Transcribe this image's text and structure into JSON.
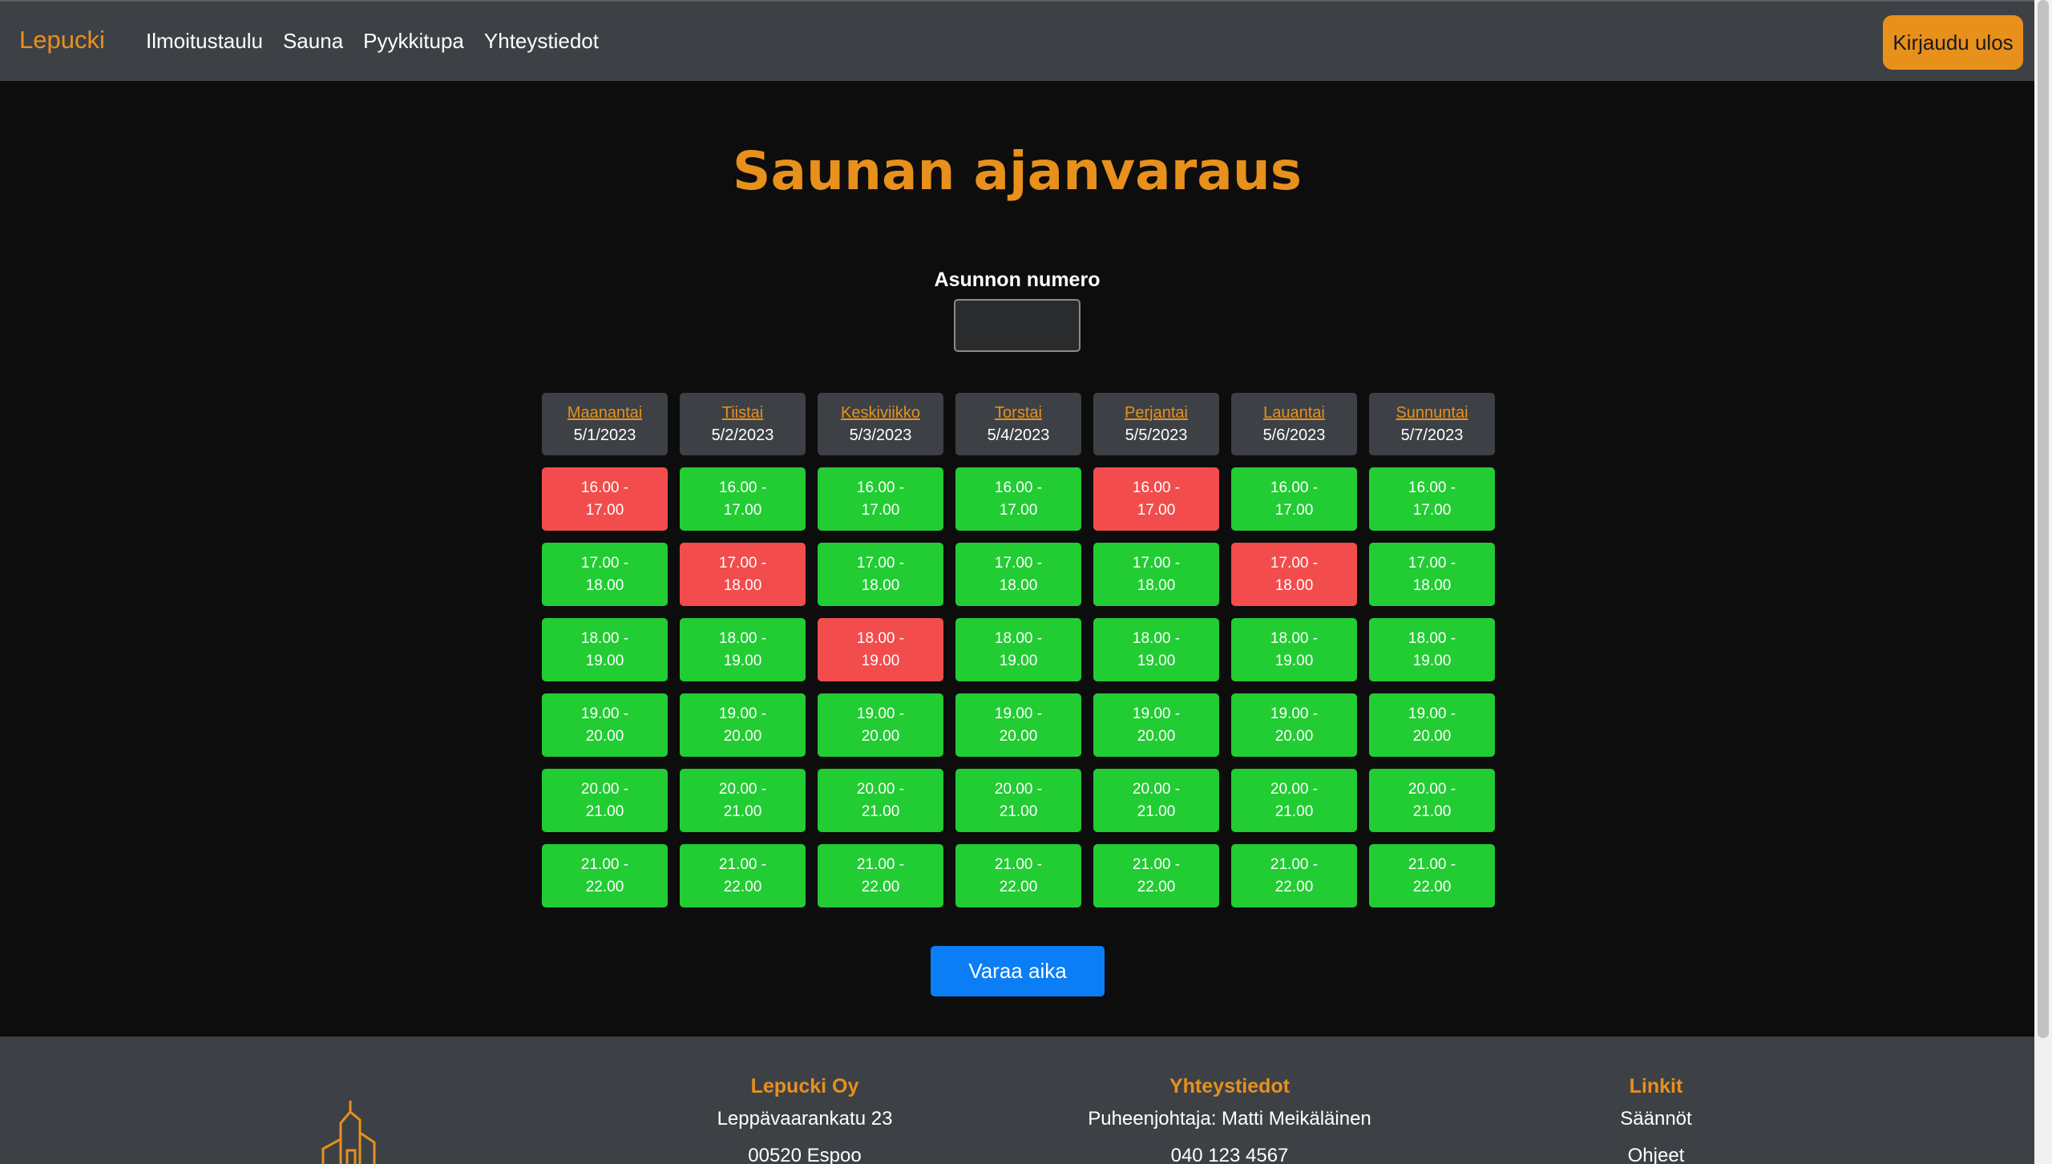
{
  "nav": {
    "brand": "Lepucki",
    "links": [
      "Ilmoitustaulu",
      "Sauna",
      "Pyykkitupa",
      "Yhteystiedot"
    ],
    "logout_label": "Kirjaudu ulos"
  },
  "main": {
    "title": "Saunan ajanvaraus",
    "apartment_label": "Asunnon numero",
    "apartment_value": "",
    "book_button": "Varaa aika"
  },
  "schedule": {
    "days": [
      {
        "name": "Maanantai",
        "date": "5/1/2023"
      },
      {
        "name": "Tiistai",
        "date": "5/2/2023"
      },
      {
        "name": "Keskiviikko",
        "date": "5/3/2023"
      },
      {
        "name": "Torstai",
        "date": "5/4/2023"
      },
      {
        "name": "Perjantai",
        "date": "5/5/2023"
      },
      {
        "name": "Lauantai",
        "date": "5/6/2023"
      },
      {
        "name": "Sunnuntai",
        "date": "5/7/2023"
      }
    ],
    "slots": [
      "16.00 - 17.00",
      "17.00 - 18.00",
      "18.00 - 19.00",
      "19.00 - 20.00",
      "20.00 - 21.00",
      "21.00 - 22.00"
    ],
    "booked": [
      [
        0,
        0
      ],
      [
        1,
        1
      ],
      [
        2,
        2
      ],
      [
        4,
        0
      ],
      [
        5,
        1
      ]
    ],
    "colors": {
      "free": "#22cc33",
      "booked": "#f24c4c",
      "accent": "#e8901c"
    }
  },
  "footer": {
    "company": {
      "title": "Lepucki Oy",
      "lines": [
        "Leppävaarankatu 23",
        "00520 Espoo"
      ]
    },
    "contact": {
      "title": "Yhteystiedot",
      "lines": [
        "Puheenjohtaja: Matti Meikäläinen",
        "040 123 4567"
      ]
    },
    "links": {
      "title": "Linkit",
      "lines": [
        "Säännöt",
        "Ohjeet"
      ]
    },
    "logo_icon": "building-icon"
  }
}
